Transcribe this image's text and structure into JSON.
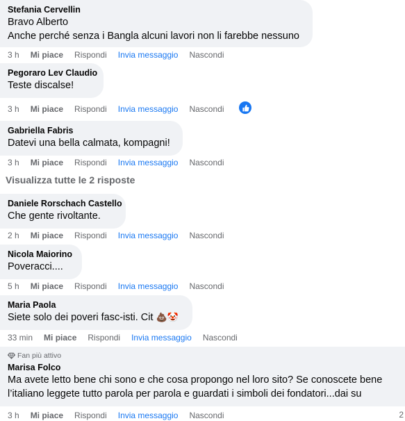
{
  "actions": {
    "like": "Mi piace",
    "reply": "Rispondi",
    "message": "Invia messaggio",
    "hide": "Nascondi"
  },
  "comments": [
    {
      "author": "Stefania Cervellin",
      "lines": [
        "Bravo Alberto",
        "Anche perché senza i Bangla alcuni lavori non li farebbe nessuno"
      ],
      "time": "3 h"
    },
    {
      "author": "Pegoraro Lev Claudio",
      "text": "Teste discalse!",
      "time": "3 h",
      "reaction_icon": "like-reaction-icon"
    },
    {
      "author": "Gabriella Fabris",
      "text": "Datevi una bella calmata, kompagni!",
      "time": "3 h"
    },
    {
      "author": "Daniele Rorschach Castello",
      "text": "Che gente rivoltante.",
      "time": "2 h"
    },
    {
      "author": "Nicola Maiorino",
      "text": "Poveracci....",
      "time": "5 h"
    },
    {
      "author": "Maria Paola",
      "text": "Siete solo dei poveri fasc-isti. Cit",
      "emoji": "💩🤡",
      "time": "33 min"
    },
    {
      "badge": "Fan più attivo",
      "author": "Marisa Folco",
      "text": "Ma avete letto bene chi sono e che cosa propongo nel loro sito? Se conoscete bene l’italiano leggete tutto parola per parola e guardati i simboli dei fondatori...dai su",
      "time": "3 h"
    }
  ],
  "view_all_replies": "Visualizza tutte le 2 risposte",
  "edge_count": "2",
  "colors": {
    "bubble": "#f0f2f5",
    "link": "#1877f2",
    "secondary": "#65676b"
  }
}
